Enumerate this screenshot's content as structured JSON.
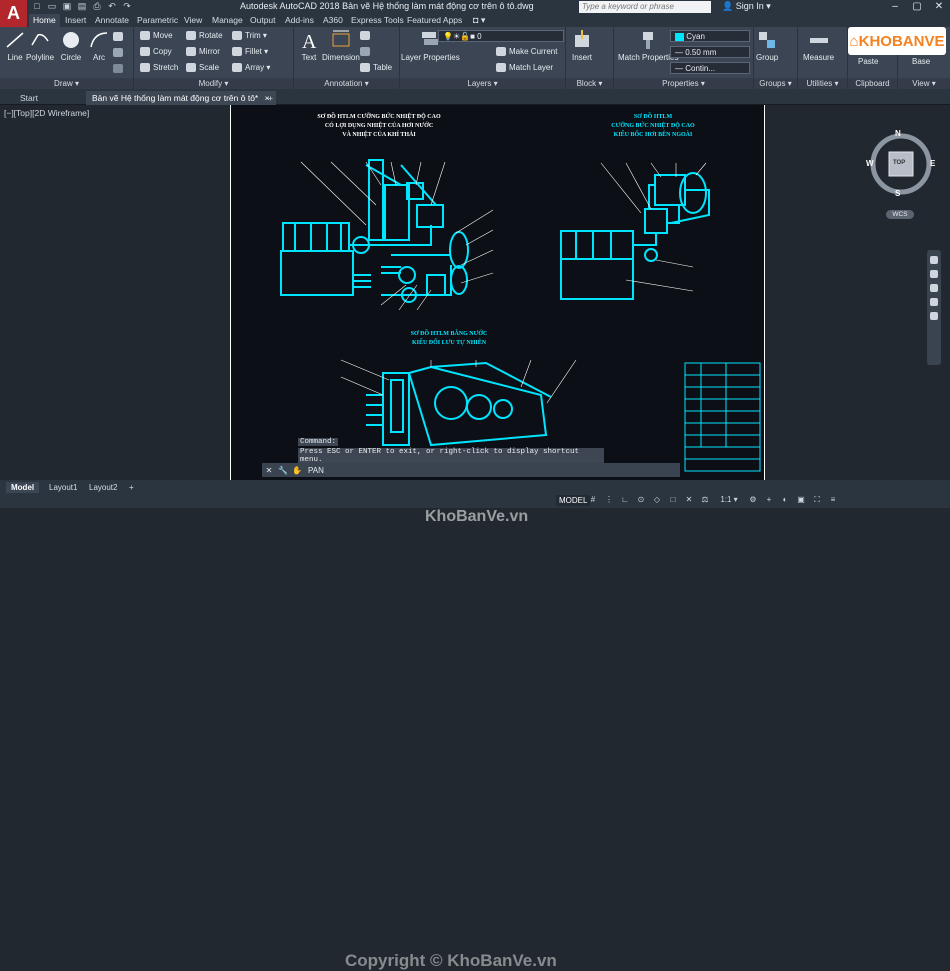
{
  "app": {
    "logo_letter": "A",
    "title": "Autodesk AutoCAD 2018    Bản vẽ Hệ thống làm mát động cơ trên ô tô.dwg",
    "search_placeholder": "Type a keyword or phrase",
    "signin": "Sign In"
  },
  "ribbon_tabs": [
    "Home",
    "Insert",
    "Annotate",
    "Parametric",
    "View",
    "Manage",
    "Output",
    "Add-ins",
    "A360",
    "Express Tools",
    "Featured Apps"
  ],
  "ribbon": {
    "draw": {
      "label": "Draw ▾",
      "line": "Line",
      "polyline": "Polyline",
      "circle": "Circle",
      "arc": "Arc"
    },
    "modify": {
      "label": "Modify ▾",
      "move": "Move",
      "rotate": "Rotate",
      "trim": "Trim ▾",
      "copy": "Copy",
      "mirror": "Mirror",
      "fillet": "Fillet ▾",
      "stretch": "Stretch",
      "scale": "Scale",
      "array": "Array ▾"
    },
    "annotation": {
      "label": "Annotation ▾",
      "text": "Text",
      "dimension": "Dimension",
      "table": "Table"
    },
    "layers": {
      "label": "Layers ▾",
      "layer_properties": "Layer Properties",
      "current_layer": "0",
      "make_current": "Make Current",
      "match_layer": "Match Layer"
    },
    "block": {
      "label": "Block ▾",
      "insert": "Insert"
    },
    "properties": {
      "label": "Properties ▾",
      "match_properties": "Match Properties",
      "color": "Cyan",
      "lineweight": "0.50 mm",
      "linetype": "Contin..."
    },
    "groups": {
      "label": "Groups ▾",
      "group": "Group"
    },
    "utilities": {
      "label": "Utilities ▾",
      "measure": "Measure"
    },
    "clipboard": {
      "label": "Clipboard",
      "paste": "Paste"
    },
    "view": {
      "label": "View ▾",
      "base": "Base"
    }
  },
  "brand": {
    "name": "KHOBANVE"
  },
  "doc_tabs": {
    "start": "Start",
    "active": "Bản vẽ Hệ thống làm mát động cơ trên ô tô*",
    "close": "×",
    "add": "+"
  },
  "viewport": {
    "label": "[−][Top][2D Wireframe]"
  },
  "drawing": {
    "title_left_1": "SƠ ĐỒ HTLM CƯỠNG BỨC NHIỆT ĐỘ CAO",
    "title_left_2": "CÓ LỢI DỤNG NHIỆT CỦA HƠI NƯỚC",
    "title_left_3": "VÀ NHIỆT CỦA KHÍ THẢI",
    "title_right_1": "SƠ ĐỒ HTLM",
    "title_right_2": "CƯỠNG BỨC NHIỆT ĐỘ CAO",
    "title_right_3": "KIỂU BỐC HƠI BÊN NGOÀI",
    "title_bottom_1": "SƠ ĐỒ HTLM BẰNG NƯỚC",
    "title_bottom_2": "KIỂU ĐỐI LƯU TỰ NHIÊN"
  },
  "viewcube": {
    "n": "N",
    "s": "S",
    "e": "E",
    "w": "W",
    "top": "TOP",
    "wcs": "WCS"
  },
  "command": {
    "line1": "Command:",
    "line2": "Press ESC or ENTER to exit, or right-click to display shortcut menu.",
    "input": "PAN"
  },
  "watermarks": {
    "center": "KhoBanVe.vn",
    "bottom": "Copyright © KhoBanVe.vn"
  },
  "layout_tabs": [
    "Model",
    "Layout1",
    "Layout2"
  ],
  "status": {
    "model": "MODEL",
    "scale": "1:1 ▾"
  },
  "colors": {
    "accent": "#00e5ff",
    "paper": "#0c1016",
    "ribbon": "#3b4553"
  }
}
